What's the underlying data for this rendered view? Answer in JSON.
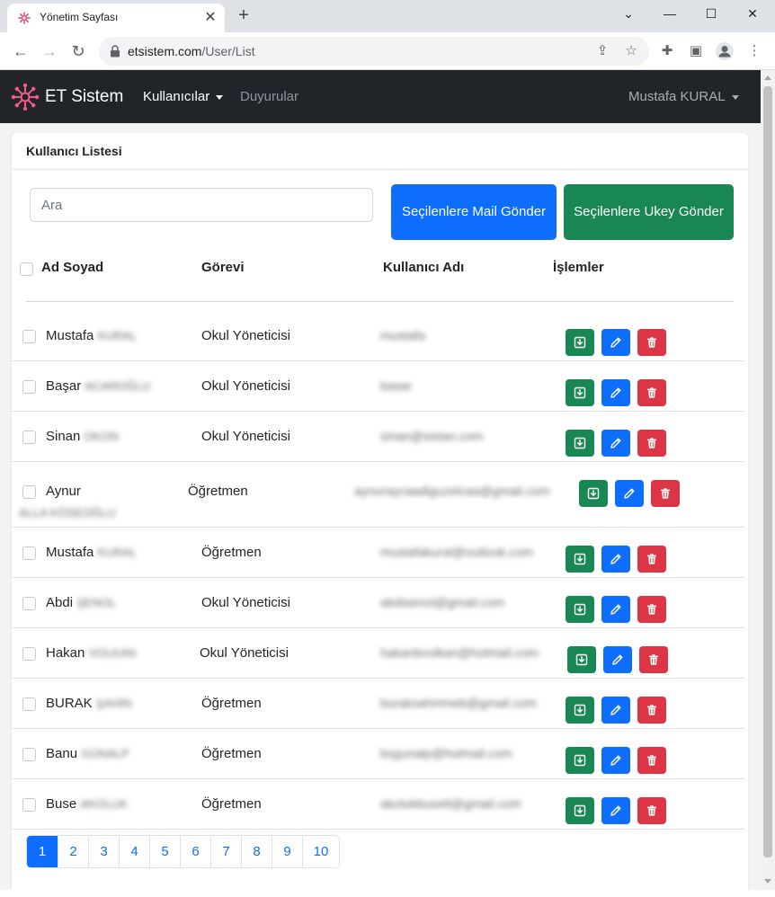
{
  "browser": {
    "tab_title": "Yönetim Sayfası",
    "url_host": "etsistem.com",
    "url_path": "/User/List"
  },
  "navbar": {
    "brand": "ET Sistem",
    "menu": [
      {
        "label": "Kullanıcılar"
      },
      {
        "label": "Duyurular"
      }
    ],
    "user": "Mustafa KURAL"
  },
  "card": {
    "title": "Kullanıcı Listesi",
    "search_placeholder": "Ara",
    "mail_button": "Seçilenlere Mail Gönder",
    "ukey_button": "Seçilenlere Ukey Gönder"
  },
  "table": {
    "headers": [
      "Ad Soyad",
      "Görevi",
      "Kullanıcı Adı",
      "İşlemler"
    ],
    "rows": [
      {
        "first": "Mustafa",
        "last": "KURAL",
        "role": "Okul Yöneticisi",
        "username": "mustafa"
      },
      {
        "first": "Başar",
        "last": "ACAROĞLU",
        "role": "Okul Yöneticisi",
        "username": "basar"
      },
      {
        "first": "Sinan",
        "last": "OKON",
        "role": "Okul Yöneticisi",
        "username": "sinan@sistan.com"
      },
      {
        "first": "Aynur",
        "last": "ALLA KÖSEOĞLU",
        "role": "Öğretmen",
        "username": "aynuraycaadiguzelcaa@gmail.com"
      },
      {
        "first": "Mustafa",
        "last": "KURAL",
        "role": "Öğretmen",
        "username": "mustafakural@outlook.com"
      },
      {
        "first": "Abdi",
        "last": "ŞENOL",
        "role": "Okul Yöneticisi",
        "username": "abdisenol@gmail.com"
      },
      {
        "first": "Hakan",
        "last": "VOLKAN",
        "role": "Okul Yöneticisi",
        "username": "hakanbvolkan@hotmail.com"
      },
      {
        "first": "BURAK",
        "last": "ŞAHİN",
        "role": "Öğretmen",
        "username": "buraksahinmeb@gmail.com"
      },
      {
        "first": "Banu",
        "last": "GÜNALP",
        "role": "Öğretmen",
        "username": "bsgunalp@hotmail.com"
      },
      {
        "first": "Buse",
        "last": "AKOLUK",
        "role": "Öğretmen",
        "username": "akolukbuse8@gmail.com"
      }
    ]
  },
  "pagination": {
    "pages": [
      "1",
      "2",
      "3",
      "4",
      "5",
      "6",
      "7",
      "8",
      "9",
      "10"
    ],
    "current": "1"
  },
  "colors": {
    "primary": "#0d6efd",
    "success": "#198754",
    "danger": "#dc3545",
    "navbar": "#212529"
  }
}
